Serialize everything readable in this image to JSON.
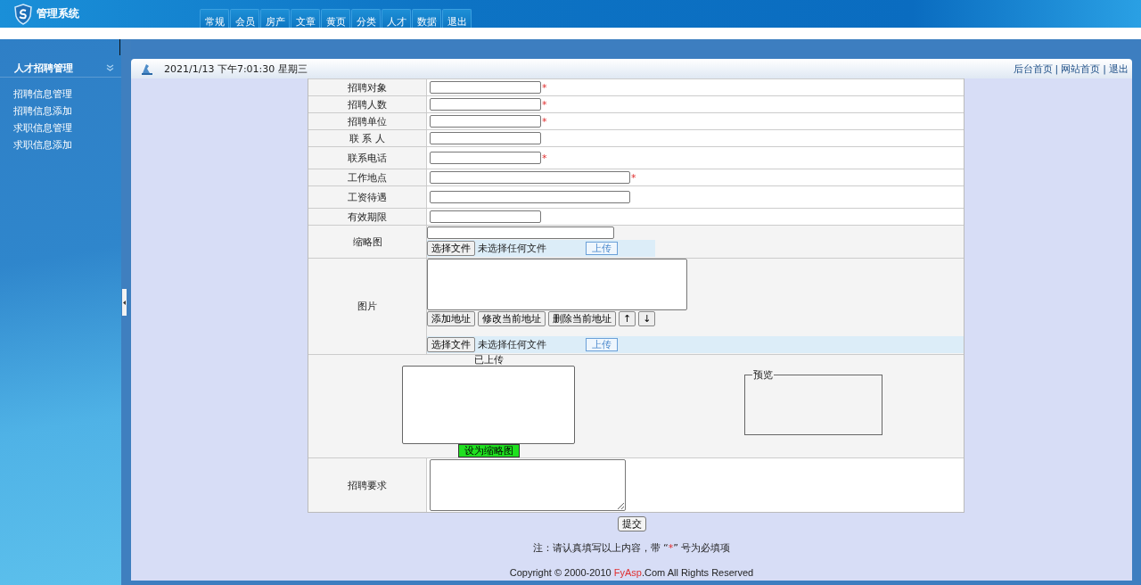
{
  "header": {
    "title": "管理系统"
  },
  "nav": [
    {
      "label": "常规",
      "selected": false
    },
    {
      "label": "会员",
      "selected": false
    },
    {
      "label": "房产",
      "selected": false
    },
    {
      "label": "文章",
      "selected": false
    },
    {
      "label": "黄页",
      "selected": false
    },
    {
      "label": "分类",
      "selected": false
    },
    {
      "label": "人才",
      "selected": false
    },
    {
      "label": "数据",
      "selected": false
    },
    {
      "label": "退出",
      "selected": false
    }
  ],
  "sidebar": {
    "title": "人才招聘管理",
    "items": [
      "招聘信息管理",
      "招聘信息添加",
      "求职信息管理",
      "求职信息添加"
    ]
  },
  "topbar": {
    "datetime": "2021/1/13 下午7:01:30 星期三",
    "links": [
      "后台首页",
      "网站首页",
      "退出"
    ],
    "separator": "|"
  },
  "form": {
    "rows": [
      {
        "kind": "text",
        "label": "招聘对象",
        "wide": false,
        "required": true
      },
      {
        "kind": "text",
        "label": "招聘人数",
        "wide": false,
        "required": true
      },
      {
        "kind": "text",
        "label": "招聘单位",
        "wide": false,
        "required": true
      },
      {
        "kind": "text",
        "label": "联 系 人",
        "wide": false,
        "required": false
      },
      {
        "kind": "text",
        "label": "联系电话",
        "wide": false,
        "required": true
      },
      {
        "kind": "text",
        "label": "工作地点",
        "wide": true,
        "required": true
      },
      {
        "kind": "text",
        "label": "工资待遇",
        "wide": true,
        "required": false
      },
      {
        "kind": "text",
        "label": "有效期限",
        "wide": false,
        "required": false
      },
      {
        "kind": "thumbnail",
        "label": "缩略图",
        "file_button": "选择文件",
        "file_status": "未选择任何文件",
        "upload_button": "上传"
      },
      {
        "kind": "images",
        "label": "图片",
        "buttons": [
          "添加地址",
          "修改当前地址",
          "删除当前地址",
          "↑",
          "↓"
        ],
        "file_button": "选择文件",
        "file_status": "未选择任何文件",
        "upload_button": "上传"
      },
      {
        "kind": "uploaded",
        "caption": "已上传",
        "set_button": "设为缩略图",
        "preview_legend": "预览"
      },
      {
        "kind": "textarea",
        "label": "招聘要求"
      }
    ],
    "required_mark": "*",
    "submit": "提交"
  },
  "note": {
    "before": "注：请认真填写以上内容，带 “",
    "mark": "*",
    "after": "” 号为必填项"
  },
  "footer": {
    "before": "Copyright © 2000-2010 ",
    "brand": "FyAsp",
    "after": ".Com All Rights Reserved"
  }
}
